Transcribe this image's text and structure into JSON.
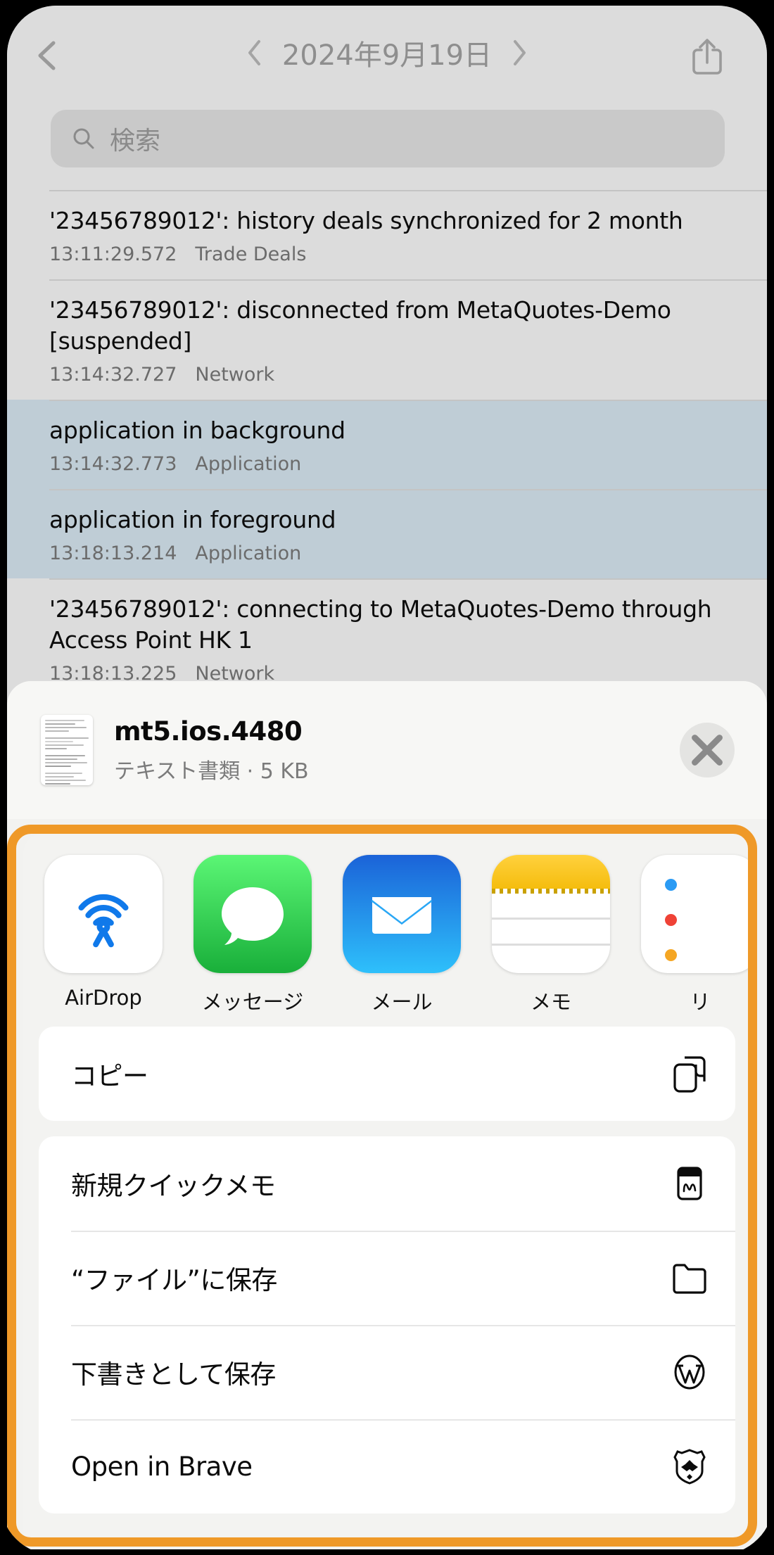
{
  "navbar": {
    "back_icon": "chevron-left-icon",
    "prev_icon": "chevron-left-icon",
    "title": "2024年9月19日",
    "next_icon": "chevron-right-icon",
    "share_icon": "share-icon"
  },
  "search": {
    "icon": "search-icon",
    "placeholder": "検索",
    "value": ""
  },
  "log": {
    "rows": [
      {
        "message": "'23456789012': history deals synchronized for 2 month",
        "time": "13:11:29.572",
        "category": "Trade Deals",
        "selected": false
      },
      {
        "message": "'23456789012': disconnected from MetaQuotes-Demo [suspended]",
        "time": "13:14:32.727",
        "category": "Network",
        "selected": false
      },
      {
        "message": "application in background",
        "time": "13:14:32.773",
        "category": "Application",
        "selected": true
      },
      {
        "message": "application in foreground",
        "time": "13:18:13.214",
        "category": "Application",
        "selected": true
      },
      {
        "message": "'23456789012': connecting to MetaQuotes-Demo through Access Point HK 1",
        "time": "13:18:13.225",
        "category": "Network",
        "selected": false
      }
    ]
  },
  "share_sheet": {
    "attachment": {
      "thumbnail_icon": "text-document-thumbnail",
      "name": "mt5.ios.4480",
      "subtitle": "テキスト書類 · 5 KB",
      "close_icon": "close-icon"
    },
    "apps": [
      {
        "label": "AirDrop",
        "icon": "airdrop-icon"
      },
      {
        "label": "メッセージ",
        "icon": "messages-icon"
      },
      {
        "label": "メール",
        "icon": "mail-icon"
      },
      {
        "label": "メモ",
        "icon": "notes-icon"
      },
      {
        "label": "リ",
        "icon": "reminders-icon"
      }
    ],
    "action_groups": [
      {
        "rows": [
          {
            "label": "コピー",
            "icon": "copy-icon"
          }
        ]
      },
      {
        "rows": [
          {
            "label": "新規クイックメモ",
            "icon": "quick-note-icon"
          },
          {
            "label": "“ファイル”に保存",
            "icon": "folder-icon"
          },
          {
            "label": "下書きとして保存",
            "icon": "wordpress-icon"
          },
          {
            "label": "Open in Brave",
            "icon": "brave-icon"
          }
        ]
      }
    ]
  },
  "highlight": {
    "color": "#ef9928",
    "name": "share-sheet-highlight"
  }
}
